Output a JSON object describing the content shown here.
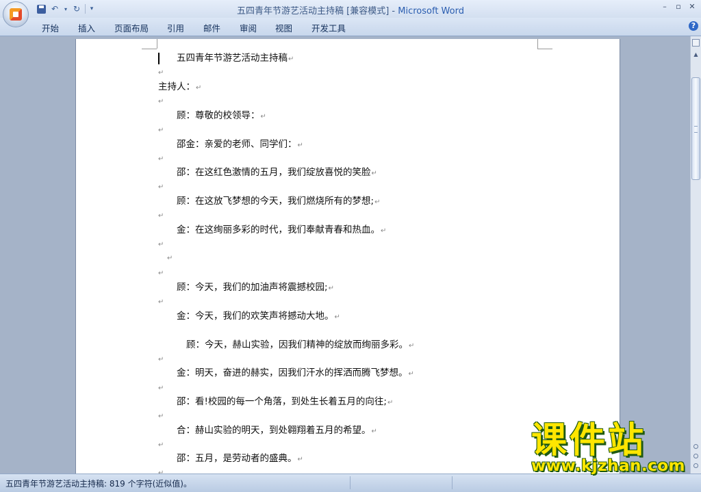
{
  "window": {
    "title_doc": "五四青年节游艺活动主持稿 [兼容模式] - ",
    "title_app": "Microsoft Word"
  },
  "ribbon": {
    "tabs": [
      "开始",
      "插入",
      "页面布局",
      "引用",
      "邮件",
      "审阅",
      "视图",
      "开发工具"
    ]
  },
  "document": {
    "lines": [
      "五四青年节游艺活动主持稿",
      "主持人：",
      "顾：尊敬的校领导：",
      "邵金：亲爱的老师、同学们：",
      "邵：在这红色激情的五月，我们绽放喜悦的笑脸",
      "顾：在这放飞梦想的今天，我们燃烧所有的梦想;",
      "金：在这绚丽多彩的时代，我们奉献青春和热血。",
      "顾：今天，我们的加油声将震撼校园;",
      "金：今天，我们的欢笑声将撼动大地。",
      "顾：今天，赫山实验，因我们精神的绽放而绚丽多彩。",
      "金：明天，奋进的赫实，因我们汗水的挥洒而腾飞梦想。",
      "邵：看!校园的每一个角落，到处生长着五月的向往;",
      "合：赫山实验的明天，到处翱翔着五月的希望。",
      "邵：五月，是劳动者的盛典。"
    ],
    "paragraph_mark": "↵"
  },
  "status": {
    "text": "五四青年节游艺活动主持稿: 819 个字符(近似值)。"
  },
  "watermark": {
    "title": "课件站",
    "url": "www.kjzhan.com"
  }
}
